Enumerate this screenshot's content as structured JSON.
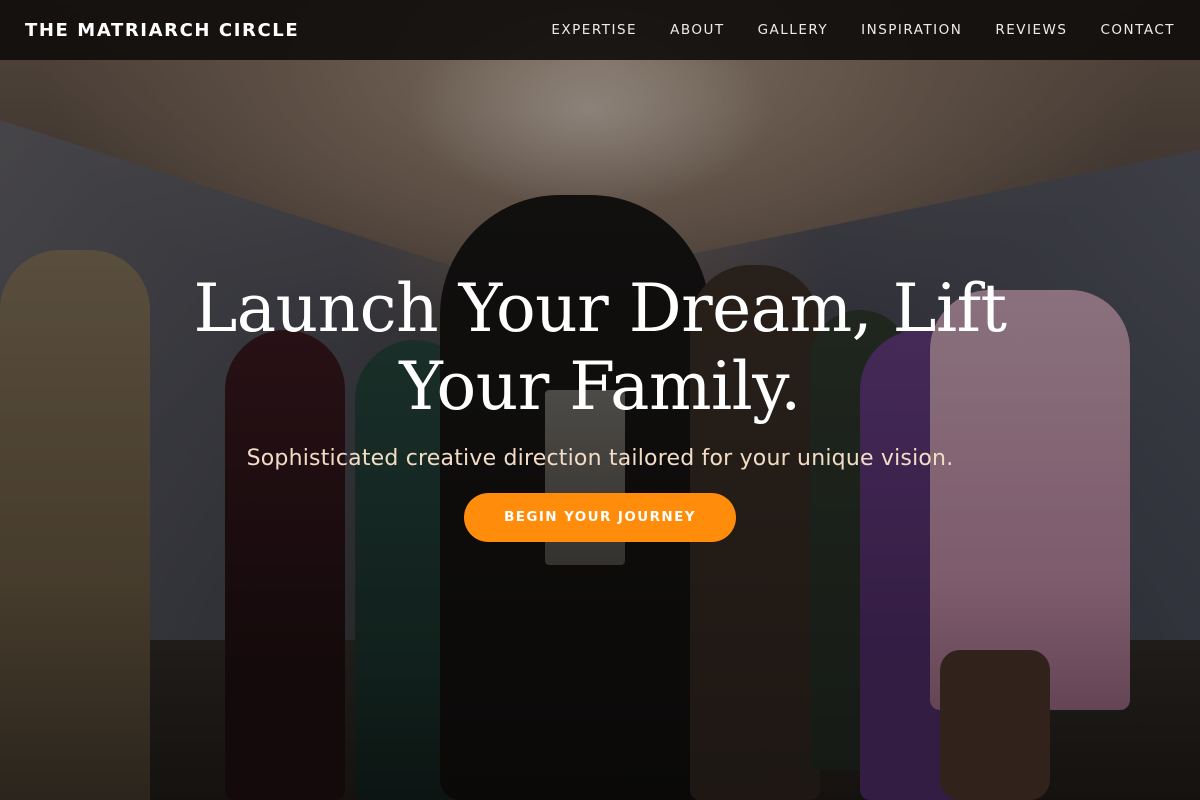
{
  "brand": {
    "name": "THE MATRIARCH CIRCLE"
  },
  "nav": {
    "items": [
      {
        "label": "EXPERTISE"
      },
      {
        "label": "ABOUT"
      },
      {
        "label": "GALLERY"
      },
      {
        "label": "INSPIRATION"
      },
      {
        "label": "REVIEWS"
      },
      {
        "label": "CONTACT"
      }
    ]
  },
  "hero": {
    "headline": "Launch Your Dream, Lift Your Family.",
    "subheadline": "Sophisticated creative direction tailored for your unique vision.",
    "cta_label": "BEGIN YOUR JOURNEY"
  },
  "colors": {
    "accent": "#ff8c0a",
    "navbar_bg": "#0e0c0b",
    "subheadline_text": "#f2dcc6"
  }
}
